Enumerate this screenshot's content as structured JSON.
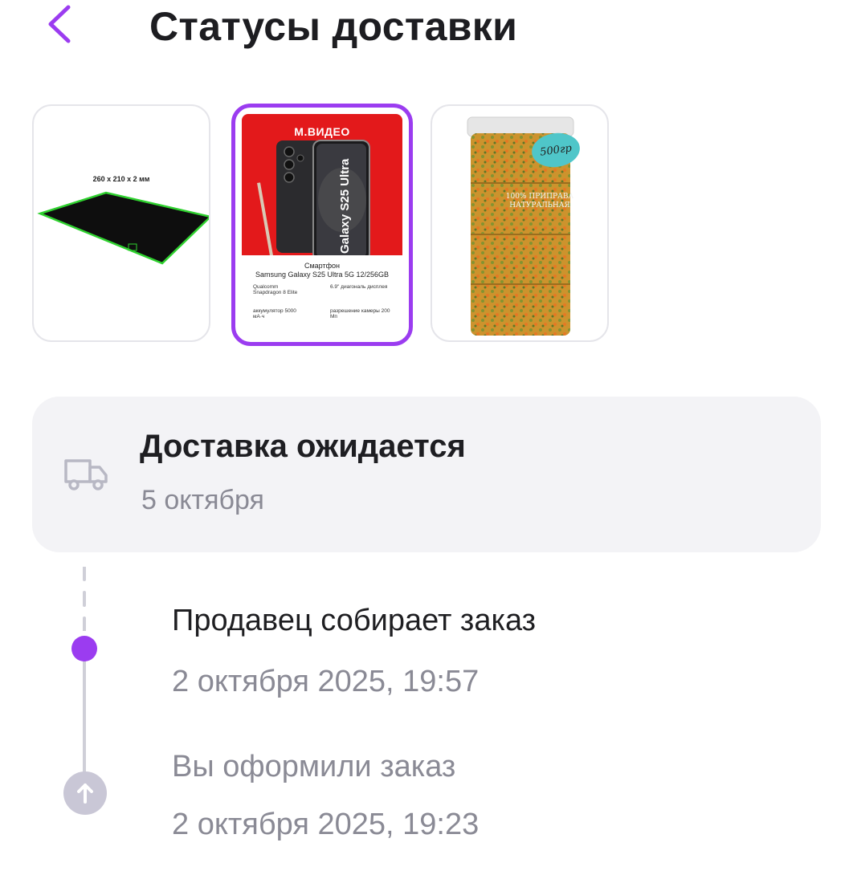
{
  "header": {
    "title": "Статусы доставки"
  },
  "products": [
    {
      "caption": "260 x 210 x 2 мм"
    },
    {
      "brand": "М.ВИДЕО",
      "phone_label": "Galaxy S25 Ultra",
      "title_line1": "Смартфон",
      "title_line2": "Samsung Galaxy S25 Ultra 5G 12/256GB",
      "spec1": "Qualcomm Snapdragon 8 Elite",
      "spec2": "6.9\" диагональ дисплея",
      "spec3": "аккумулятор 5000 мА·ч",
      "spec4": "разрешение камеры 200 Мп"
    },
    {
      "badge": "500гр",
      "label": "100% ПРИПРАВА НАТУРАЛЬНАЯ"
    }
  ],
  "delivery": {
    "status": "Доставка ожидается",
    "date": "5 октября"
  },
  "timeline": [
    {
      "title": "Продавец собирает заказ",
      "date": "2 октября 2025, 19:57"
    },
    {
      "title": "Вы оформили заказ",
      "date": "2 октября 2025, 19:23"
    }
  ],
  "colors": {
    "accent": "#9b3cf0",
    "muted": "#8a8a95",
    "card_bg": "#f3f3f6"
  }
}
